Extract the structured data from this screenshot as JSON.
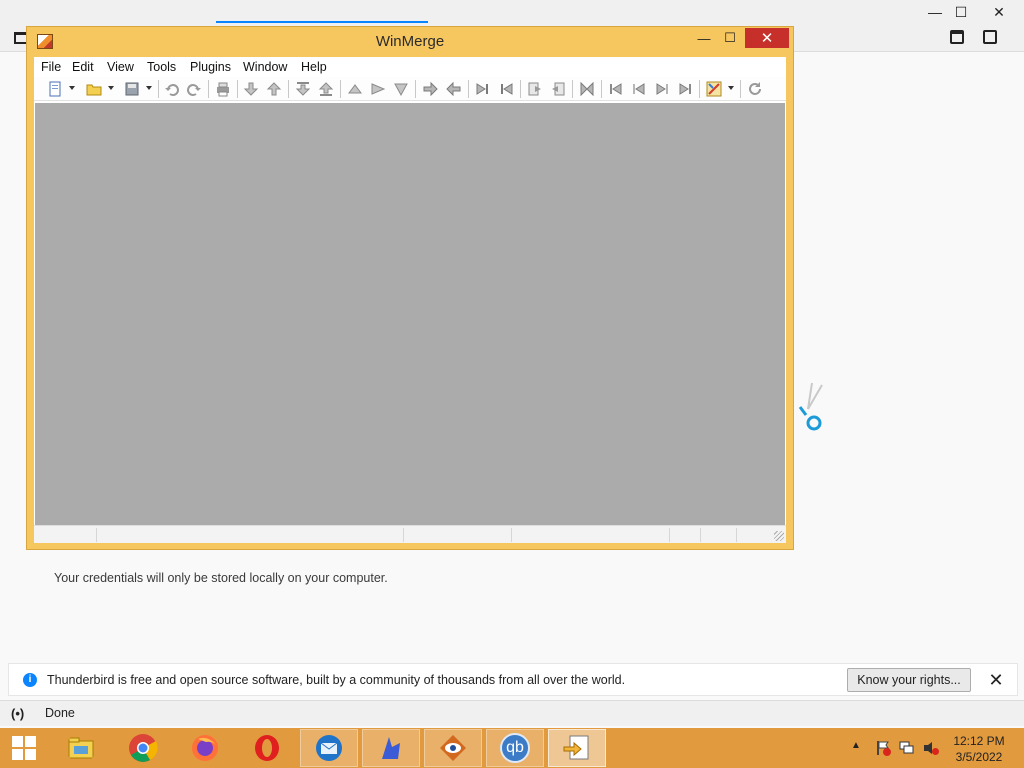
{
  "thunderbird": {
    "credentials_note": "Your credentials will only be stored locally on your computer.",
    "notification_text": "Thunderbird is free and open source software, built by a community of thousands from all over the world.",
    "know_rights_label": "Know your rights...",
    "close_glyph": "✕",
    "status_text": "Done",
    "status_glyph": "(•)",
    "window_controls": {
      "minimize": "—",
      "maximize": "☐",
      "close": "✕"
    }
  },
  "winmerge": {
    "title": "WinMerge",
    "controls": {
      "minimize": "—",
      "maximize": "☐",
      "close": "✕"
    },
    "menu": [
      "File",
      "Edit",
      "View",
      "Tools",
      "Plugins",
      "Window",
      "Help"
    ],
    "toolbar_icons": [
      "new-icon",
      "open-icon",
      "save-icon",
      "undo-icon",
      "redo-icon",
      "print-icon",
      "next-diff-icon",
      "prev-diff-icon",
      "first-diff-icon",
      "last-diff-icon",
      "current-diff-icon",
      "next-conflict-icon",
      "prev-conflict-icon",
      "copy-right-icon",
      "copy-left-icon",
      "copy-right-advance-icon",
      "copy-left-advance-icon",
      "all-right-icon",
      "all-left-icon",
      "merge-icon",
      "nav-first-icon",
      "nav-prev-icon",
      "nav-next-icon",
      "nav-last-icon",
      "options-icon",
      "refresh-icon"
    ]
  },
  "taskbar": {
    "apps": [
      {
        "name": "start-button"
      },
      {
        "name": "file-explorer-icon",
        "color": "#e8b84a"
      },
      {
        "name": "chrome-icon",
        "color": "#34a853"
      },
      {
        "name": "firefox-icon",
        "color": "#ff7139"
      },
      {
        "name": "opera-icon",
        "color": "#e0201f"
      },
      {
        "name": "thunderbird-icon",
        "color": "#1f73c9"
      },
      {
        "name": "app-blue-icon",
        "color": "#3b5cd6"
      },
      {
        "name": "app-eye-icon",
        "color": "#d2691e"
      },
      {
        "name": "qbittorrent-icon",
        "color": "#3c7cc7",
        "label": "qb"
      },
      {
        "name": "winmerge-task-icon",
        "color": "#f2b53a"
      }
    ],
    "clock_time": "12:12 PM",
    "clock_date": "3/5/2022"
  },
  "colors": {
    "taskbar": "#e29a3e",
    "winmerge_frame": "#f6c65f",
    "workspace": "#ababab",
    "accent": "#0a84ff"
  }
}
